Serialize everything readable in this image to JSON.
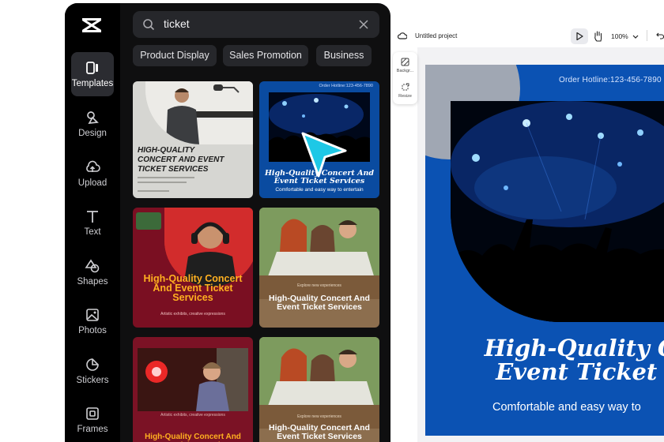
{
  "sidebar": {
    "items": [
      {
        "label": "Templates",
        "icon": "templates-icon",
        "active": true
      },
      {
        "label": "Design",
        "icon": "design-icon"
      },
      {
        "label": "Upload",
        "icon": "upload-icon"
      },
      {
        "label": "Text",
        "icon": "text-icon"
      },
      {
        "label": "Shapes",
        "icon": "shapes-icon"
      },
      {
        "label": "Photos",
        "icon": "photos-icon"
      },
      {
        "label": "Stickers",
        "icon": "stickers-icon"
      },
      {
        "label": "Frames",
        "icon": "frames-icon"
      }
    ]
  },
  "search": {
    "value": "ticket"
  },
  "categories": [
    "Product Display",
    "Sales Promotion",
    "Business"
  ],
  "templates": {
    "card1": {
      "title": "HIGH-QUALITY CONCERT AND EVENT TICKET SERVICES"
    },
    "card2": {
      "hotline": "Order Hotline:123-456-7890",
      "title": "High-Quality Concert And Event Ticket Services",
      "subtitle": "Comfortable and easy way to entertain"
    },
    "card3": {
      "title": "High-Quality Concert And Event Ticket Services",
      "subtitle": "Artistic exhibits, creative expressions"
    },
    "card4": {
      "small": "Explore new experiences",
      "title": "High-Quality Concert And Event Ticket Services"
    },
    "card5": {
      "small": "Artistic exhibits, creative expressions",
      "title": "High-Quality Concert And Event Ticket Services"
    },
    "card6": {
      "small": "Explore new experiences",
      "title": "High-Quality Concert And Event Ticket Services"
    }
  },
  "editor": {
    "project_name": "Untitled project",
    "zoom": "100%",
    "side_tools": [
      {
        "label": "Backgr..."
      },
      {
        "label": "Resize"
      }
    ]
  },
  "poster": {
    "hotline": "Order Hotline:123-456-7890",
    "title_line1": "High-Quality Con",
    "title_line2": "Event Ticket Se",
    "subtitle": "Comfortable and easy way to"
  },
  "colors": {
    "accent": "#0b52b3",
    "cursor": "#1ec8e6",
    "panel": "#0f0f10"
  }
}
